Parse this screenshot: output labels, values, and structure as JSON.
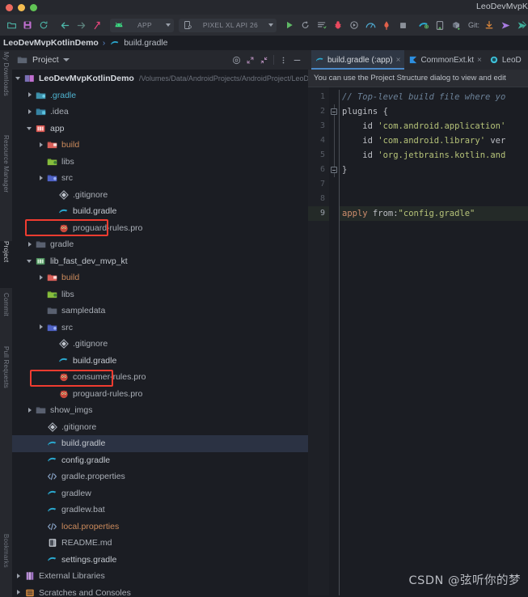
{
  "window": {
    "title": "LeoDevMvpK",
    "traffic_lights": [
      "close",
      "minimize",
      "maximize"
    ]
  },
  "toolbar": {
    "icons_left": [
      "open-folder-icon",
      "save-icon",
      "sync-icon",
      "back-arrow-icon",
      "forward-arrow-icon",
      "run-anything-icon"
    ],
    "run_config": {
      "label": "APP",
      "icon": "android-icon"
    },
    "device": {
      "label": "PIXEL XL API 26",
      "icon": "device-icon"
    },
    "icons_right": [
      "run-icon",
      "debug-attach-icon",
      "apply-changes-icon",
      "bug-icon",
      "profile-icon",
      "profiler-icon",
      "layout-inspector-icon",
      "stop-icon",
      "gradle-sync-icon",
      "avd-manager-icon",
      "sdk-manager-icon"
    ],
    "git_label": "Git:",
    "git_icons": [
      "update-project-icon",
      "commit-icon",
      "push-icon"
    ]
  },
  "breadcrumb": {
    "root": "LeoDevMvpKotlinDemo",
    "separator": "›",
    "file": "build.gradle",
    "file_icon": "gradle-icon"
  },
  "left_strip": [
    {
      "label": "My Downloads",
      "icon": "download-icon",
      "selected": false
    },
    {
      "label": "Resource Manager",
      "icon": "resource-icon",
      "selected": false
    },
    {
      "label": "Project",
      "icon": "project-icon",
      "selected": true
    },
    {
      "label": "Commit",
      "icon": "commit-icon",
      "selected": false
    },
    {
      "label": "Pull Requests",
      "icon": "pull-request-icon",
      "selected": false
    }
  ],
  "project_panel": {
    "title": "Project",
    "header_icons": [
      "target-icon",
      "expand-all-icon",
      "collapse-all-icon",
      "more-options-icon",
      "hide-icon"
    ],
    "tree": [
      {
        "label": "LeoDevMvpKotlinDemo",
        "path": "/Volumes/Data/AndroidProjects/AndroidProject/LeoD",
        "indent": 0,
        "twist": "open",
        "icon": "module-root-icon",
        "style": "bold"
      },
      {
        "label": ".gradle",
        "indent": 1,
        "twist": "closed",
        "icon": "folder-gradle-icon",
        "style": "teal"
      },
      {
        "label": ".idea",
        "indent": 1,
        "twist": "closed",
        "icon": "folder-idea-icon",
        "style": "normal"
      },
      {
        "label": "app",
        "indent": 1,
        "twist": "open",
        "icon": "module-android-icon",
        "style": "bright"
      },
      {
        "label": "build",
        "indent": 2,
        "twist": "closed",
        "icon": "folder-build-icon",
        "style": "orange"
      },
      {
        "label": "libs",
        "indent": 2,
        "twist": "none",
        "icon": "folder-libs-icon",
        "style": "normal"
      },
      {
        "label": "src",
        "indent": 2,
        "twist": "closed",
        "icon": "folder-src-icon",
        "style": "normal"
      },
      {
        "label": ".gitignore",
        "indent": 3,
        "twist": "none",
        "icon": "gitignore-icon",
        "style": "normal"
      },
      {
        "label": "build.gradle",
        "indent": 3,
        "twist": "none",
        "icon": "gradle-icon",
        "style": "bright",
        "highlight": "red-box"
      },
      {
        "label": "proguard-rules.pro",
        "indent": 3,
        "twist": "none",
        "icon": "proguard-icon",
        "style": "normal"
      },
      {
        "label": "gradle",
        "indent": 1,
        "twist": "closed",
        "icon": "folder-icon",
        "style": "normal"
      },
      {
        "label": "lib_fast_dev_mvp_kt",
        "indent": 1,
        "twist": "open",
        "icon": "module-android-lib-icon",
        "style": "bright"
      },
      {
        "label": "build",
        "indent": 2,
        "twist": "closed",
        "icon": "folder-build-icon",
        "style": "orange"
      },
      {
        "label": "libs",
        "indent": 2,
        "twist": "none",
        "icon": "folder-libs-icon",
        "style": "normal"
      },
      {
        "label": "sampledata",
        "indent": 2,
        "twist": "none",
        "icon": "folder-icon",
        "style": "normal"
      },
      {
        "label": "src",
        "indent": 2,
        "twist": "closed",
        "icon": "folder-src-icon",
        "style": "normal"
      },
      {
        "label": ".gitignore",
        "indent": 3,
        "twist": "none",
        "icon": "gitignore-icon",
        "style": "normal"
      },
      {
        "label": "build.gradle",
        "indent": 3,
        "twist": "none",
        "icon": "gradle-icon",
        "style": "bright",
        "highlight": "red-box"
      },
      {
        "label": "consumer-rules.pro",
        "indent": 3,
        "twist": "none",
        "icon": "proguard-icon",
        "style": "normal"
      },
      {
        "label": "proguard-rules.pro",
        "indent": 3,
        "twist": "none",
        "icon": "proguard-icon",
        "style": "normal"
      },
      {
        "label": "show_imgs",
        "indent": 1,
        "twist": "closed",
        "icon": "folder-icon",
        "style": "normal"
      },
      {
        "label": ".gitignore",
        "indent": 2,
        "twist": "none",
        "icon": "gitignore-icon",
        "style": "normal"
      },
      {
        "label": "build.gradle",
        "indent": 2,
        "twist": "none",
        "icon": "gradle-icon",
        "style": "bright",
        "selected": true
      },
      {
        "label": "config.gradle",
        "indent": 2,
        "twist": "none",
        "icon": "gradle-icon",
        "style": "bright"
      },
      {
        "label": "gradle.properties",
        "indent": 2,
        "twist": "none",
        "icon": "properties-icon",
        "style": "normal"
      },
      {
        "label": "gradlew",
        "indent": 2,
        "twist": "none",
        "icon": "gradle-icon",
        "style": "normal"
      },
      {
        "label": "gradlew.bat",
        "indent": 2,
        "twist": "none",
        "icon": "gradle-icon",
        "style": "normal"
      },
      {
        "label": "local.properties",
        "indent": 2,
        "twist": "none",
        "icon": "properties-icon",
        "style": "orange"
      },
      {
        "label": "README.md",
        "indent": 2,
        "twist": "none",
        "icon": "markdown-icon",
        "style": "normal"
      },
      {
        "label": "settings.gradle",
        "indent": 2,
        "twist": "none",
        "icon": "gradle-icon",
        "style": "bright"
      },
      {
        "label": "External Libraries",
        "indent": 0,
        "twist": "closed",
        "icon": "external-libraries-icon",
        "style": "normal"
      },
      {
        "label": "Scratches and Consoles",
        "indent": 0,
        "twist": "closed",
        "icon": "scratches-icon",
        "style": "normal"
      }
    ]
  },
  "editor": {
    "tabs": [
      {
        "label": "build.gradle (:app)",
        "icon": "gradle-icon",
        "active": true,
        "close": "×"
      },
      {
        "label": "CommonExt.kt",
        "icon": "kotlin-icon",
        "active": false,
        "close": "×"
      },
      {
        "label": "LeoD",
        "icon": "kotlin-class-icon",
        "active": false,
        "close": ""
      }
    ],
    "notification": "You can use the Project Structure dialog to view and edit",
    "line_numbers": [
      "1",
      "2",
      "3",
      "4",
      "5",
      "6",
      "7",
      "8",
      "9"
    ],
    "current_line": 9,
    "code_lines": [
      {
        "n": 1,
        "tokens": [
          {
            "t": "// Top-level build file where yo",
            "c": "comment"
          }
        ]
      },
      {
        "n": 2,
        "tokens": [
          {
            "t": "plugins",
            "c": "id"
          },
          {
            "t": " {",
            "c": "brace"
          }
        ]
      },
      {
        "n": 3,
        "tokens": [
          {
            "t": "    id ",
            "c": "id"
          },
          {
            "t": "'com.android.application'",
            "c": "str"
          }
        ]
      },
      {
        "n": 4,
        "tokens": [
          {
            "t": "    id ",
            "c": "id"
          },
          {
            "t": "'com.android.library'",
            "c": "str"
          },
          {
            "t": " ver",
            "c": "id"
          }
        ]
      },
      {
        "n": 5,
        "tokens": [
          {
            "t": "    id ",
            "c": "id"
          },
          {
            "t": "'org.jetbrains.kotlin.and",
            "c": "str"
          }
        ]
      },
      {
        "n": 6,
        "tokens": [
          {
            "t": "}",
            "c": "brace"
          }
        ]
      },
      {
        "n": 7,
        "tokens": [
          {
            "t": "",
            "c": "plain"
          }
        ]
      },
      {
        "n": 8,
        "tokens": [
          {
            "t": "",
            "c": "plain"
          }
        ]
      },
      {
        "n": 9,
        "tokens": [
          {
            "t": "apply",
            "c": "kw"
          },
          {
            "t": " from:",
            "c": "id"
          },
          {
            "t": "\"config.gradle\"",
            "c": "str"
          }
        ]
      }
    ]
  },
  "watermark": "CSDN @弦听你的梦",
  "colors": {
    "background": "#1b1d23",
    "panel_header": "#26282e",
    "toolbar": "#2b2d33",
    "selection": "#2b3243",
    "accent_blue": "#4a88c7",
    "highlight_box": "#f03c30",
    "gradle_icon": "#30a0c8",
    "string_green": "#b6c379",
    "comment_blue": "#6c8299",
    "keyword_orange": "#cf8e6d"
  }
}
